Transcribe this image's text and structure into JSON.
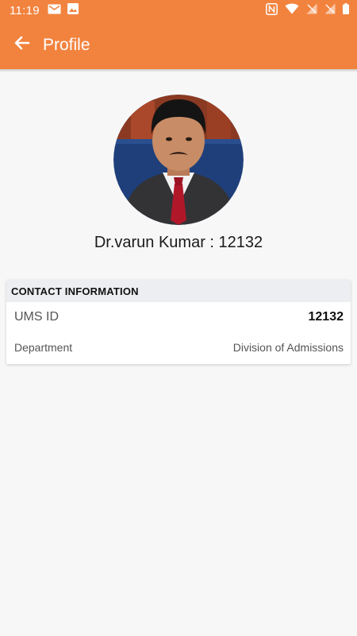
{
  "status_bar": {
    "time": "11:19",
    "left_icons": [
      "gmail-icon",
      "image-icon"
    ],
    "right_icons": [
      "nfc-icon",
      "wifi-icon",
      "signal-off-icon",
      "signal-off-icon",
      "battery-icon"
    ]
  },
  "app_bar": {
    "title": "Profile",
    "back_icon": "arrow-left-icon",
    "color": "#f2833e"
  },
  "profile": {
    "name_line": "Dr.varun Kumar : 12132"
  },
  "contact_card": {
    "header": "CONTACT INFORMATION",
    "rows": [
      {
        "label": "UMS ID",
        "value": "12132"
      },
      {
        "label": "Department",
        "value": "Division of Admissions"
      }
    ]
  }
}
